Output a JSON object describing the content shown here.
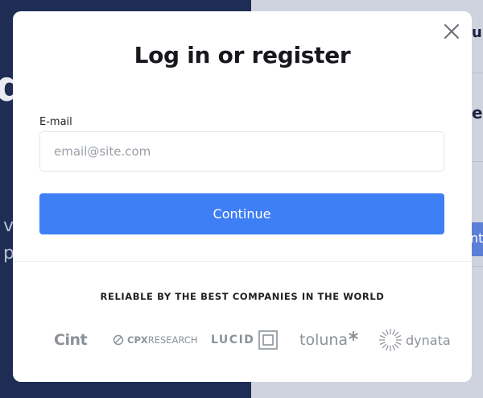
{
  "background": {
    "fragment_big": "d",
    "fragment_left_1": "v",
    "fragment_left_2": "p",
    "fragment_right_1": "u",
    "fragment_right_2": "eg",
    "fragment_button": "nt"
  },
  "modal": {
    "title": "Log in or register",
    "email_label": "E-mail",
    "email_placeholder": "email@site.com",
    "email_value": "",
    "continue_label": "Continue",
    "close_icon": "close-icon"
  },
  "partners": {
    "heading": "RELIABLE BY THE BEST COMPANIES IN THE WORLD",
    "logos": [
      {
        "name": "Cint"
      },
      {
        "name_prefix": "CPX",
        "name_suffix": " RESEARCH"
      },
      {
        "name": "LUCID"
      },
      {
        "name": "toluna"
      },
      {
        "name": "dynata"
      }
    ]
  },
  "colors": {
    "primary": "#3f7ff6",
    "backdrop": "#1f2d55"
  }
}
